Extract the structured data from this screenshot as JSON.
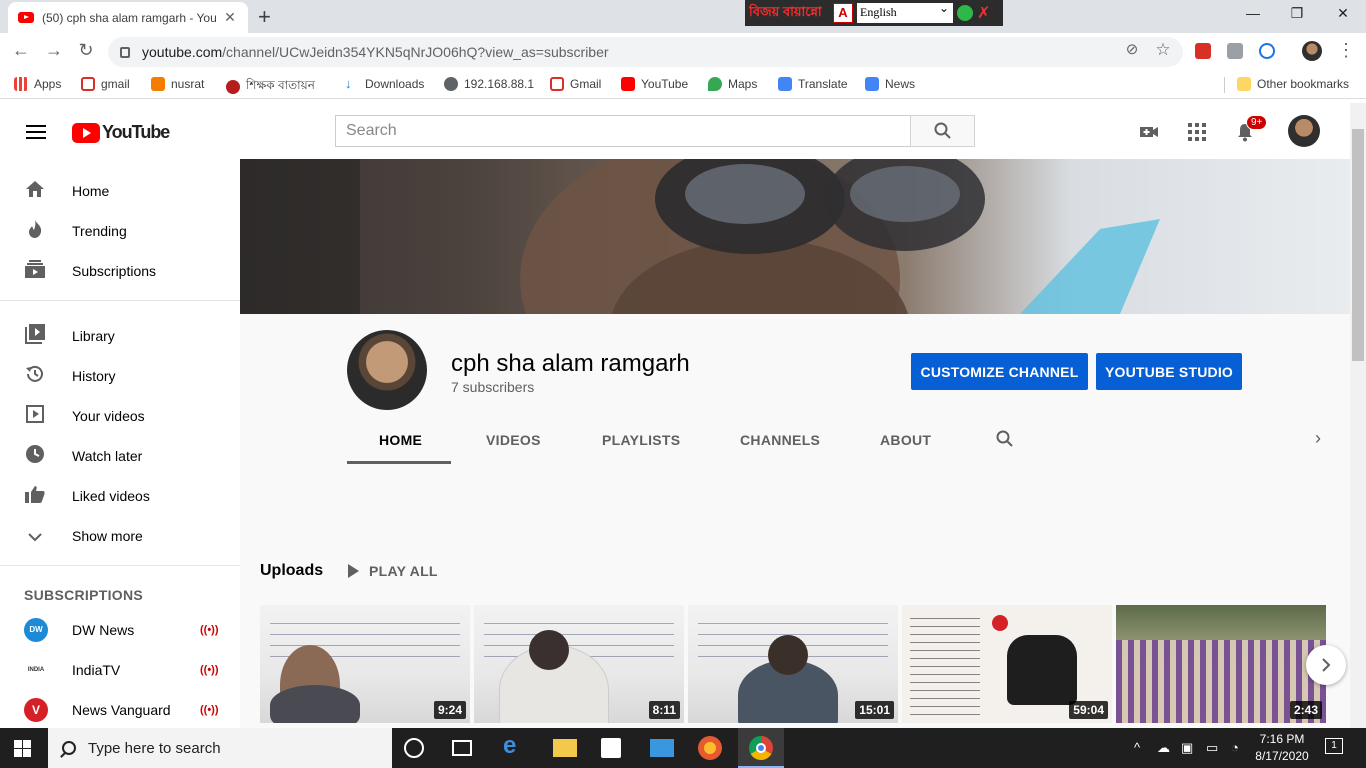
{
  "browser": {
    "tab_title": "(50) cph sha alam ramgarh - You",
    "new_tab": "+",
    "url_host": "youtube.com",
    "url_path": "/channel/UCwJeidn354YKN5qNrJO06hQ?view_as=subscriber",
    "bangla_label": "বিজয় বায়ান্নো",
    "language_select": "English",
    "bookmarks": [
      {
        "label": "Apps",
        "color": "#ea4335"
      },
      {
        "label": "gmail",
        "color": "#d93025"
      },
      {
        "label": "nusrat",
        "color": "#f57c00"
      },
      {
        "label": "শিক্ষক বাতায়ন",
        "color": "#b71c1c"
      },
      {
        "label": "Downloads",
        "color": "#1a73e8"
      },
      {
        "label": "192.168.88.1",
        "color": "#5f6368"
      },
      {
        "label": "Gmail",
        "color": "#d93025"
      },
      {
        "label": "YouTube",
        "color": "#ff0000"
      },
      {
        "label": "Maps",
        "color": "#34a853"
      },
      {
        "label": "Translate",
        "color": "#4285f4"
      },
      {
        "label": "News",
        "color": "#4285f4"
      }
    ],
    "other_bookmarks": "Other bookmarks"
  },
  "masthead": {
    "logo_text": "YouTube",
    "search_placeholder": "Search",
    "notification_count": "9+"
  },
  "sidebar": {
    "primary": [
      {
        "label": "Home",
        "icon": "home-icon"
      },
      {
        "label": "Trending",
        "icon": "flame-icon"
      },
      {
        "label": "Subscriptions",
        "icon": "subscriptions-icon"
      }
    ],
    "library": [
      {
        "label": "Library",
        "icon": "library-icon"
      },
      {
        "label": "History",
        "icon": "history-icon"
      },
      {
        "label": "Your videos",
        "icon": "play-square-icon"
      },
      {
        "label": "Watch later",
        "icon": "clock-icon"
      },
      {
        "label": "Liked videos",
        "icon": "thumbs-up-icon"
      },
      {
        "label": "Show more",
        "icon": "chevron-down-icon"
      }
    ],
    "subscriptions_heading": "SUBSCRIPTIONS",
    "subscriptions": [
      {
        "label": "DW News",
        "avatar_text": "DW",
        "color": "#1c8ad6"
      },
      {
        "label": "IndiaTV",
        "avatar_text": "INDIA",
        "color": "#ffffff"
      },
      {
        "label": "News Vanguard",
        "avatar_text": "V",
        "color": "#d62027"
      }
    ]
  },
  "channel": {
    "name": "cph sha alam ramgarh",
    "subscribers": "7 subscribers",
    "customize_button": "CUSTOMIZE CHANNEL",
    "studio_button": "YOUTUBE STUDIO",
    "tabs": [
      "HOME",
      "VIDEOS",
      "PLAYLISTS",
      "CHANNELS",
      "ABOUT"
    ],
    "active_tab": "HOME"
  },
  "uploads": {
    "title": "Uploads",
    "play_all": "PLAY ALL",
    "videos": [
      {
        "duration": "9:24"
      },
      {
        "duration": "8:11"
      },
      {
        "duration": "15:01"
      },
      {
        "duration": "59:04"
      },
      {
        "duration": "2:43"
      }
    ]
  },
  "taskbar": {
    "search_placeholder": "Type here to search",
    "time": "7:16 PM",
    "date": "8/17/2020",
    "notification_count": "1"
  }
}
